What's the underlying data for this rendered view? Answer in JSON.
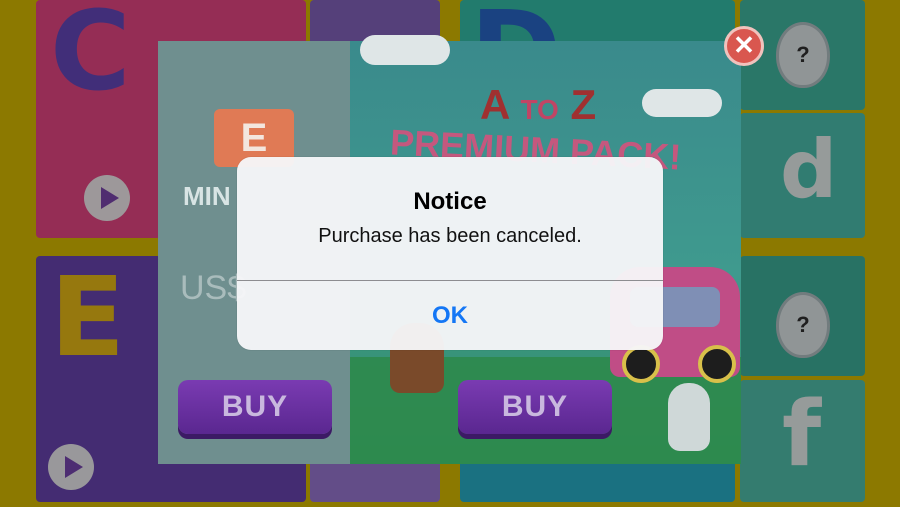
{
  "background": {
    "tiles": [
      {
        "letter": "C"
      },
      {
        "letter": "D"
      },
      {
        "letter": "E"
      },
      {
        "letter": "d"
      },
      {
        "letter": "f"
      }
    ],
    "egg_mark": "?"
  },
  "store": {
    "pack_badge": "E",
    "left_title": "MIN",
    "left_price": "US$",
    "brand": {
      "a": "A",
      "to": "TO",
      "z": "Z"
    },
    "premium_title": "PREMIUM PACK!",
    "buy_left": "BUY",
    "buy_right": "BUY",
    "close_icon": "✕"
  },
  "alert": {
    "title": "Notice",
    "message": "Purchase has been canceled.",
    "ok_label": "OK",
    "ok_color": "#1477f5"
  },
  "colors": {
    "frame": "#d8b400",
    "buy_button": "#6a31a3",
    "close_button": "#d9574f"
  }
}
